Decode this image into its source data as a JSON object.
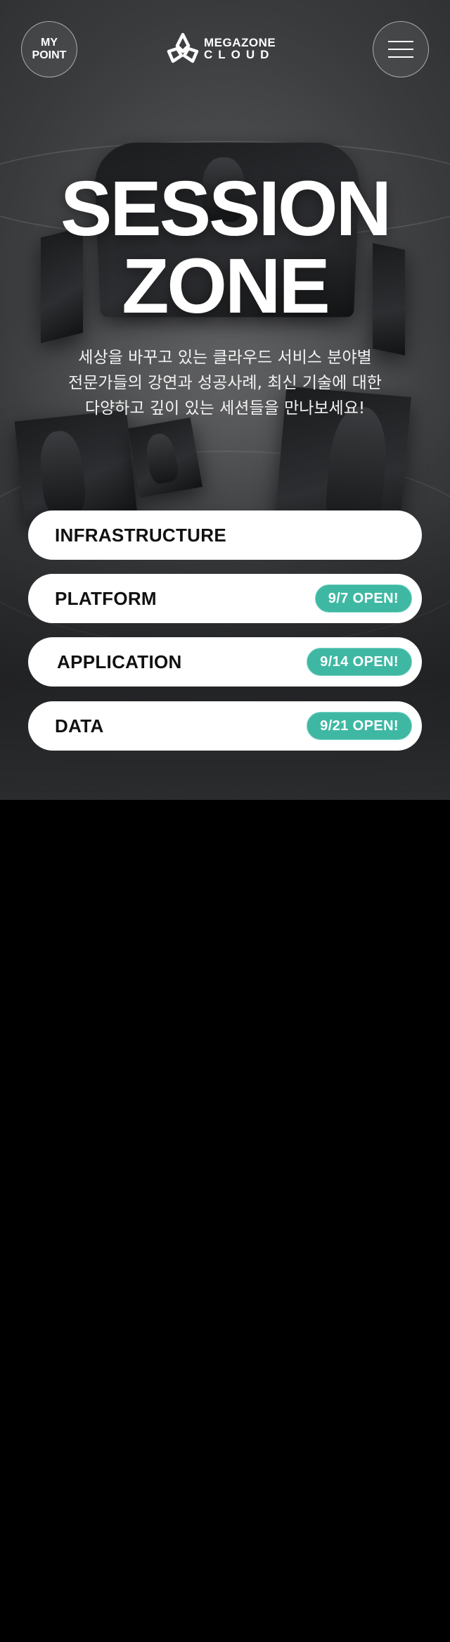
{
  "header": {
    "my_point_line1": "MY",
    "my_point_line2": "POINT",
    "logo_line1": "MEGAZONE",
    "logo_line2": "CLOUD",
    "menu_icon": "hamburger-menu-icon"
  },
  "hero": {
    "title_line1": "SESSION",
    "title_line2": "ZONE",
    "subtitle_lines": [
      "세상을 바꾸고 있는 클라우드 서비스 분야별",
      "전문가들의 강연과 성공사례, 최신 기술에 대한",
      "다양하고 깊이 있는 세션들을 만나보세요!"
    ]
  },
  "sessions": [
    {
      "label": "INFRASTRUCTURE",
      "badge": ""
    },
    {
      "label": "PLATFORM",
      "badge": "9/7 OPEN!"
    },
    {
      "label": "APPLICATION",
      "badge": "9/14 OPEN!"
    },
    {
      "label": "DATA",
      "badge": "9/21 OPEN!"
    }
  ],
  "colors": {
    "accent": "#3fb8a3",
    "pill_bg": "#ffffff",
    "page_bg": "#000000"
  }
}
